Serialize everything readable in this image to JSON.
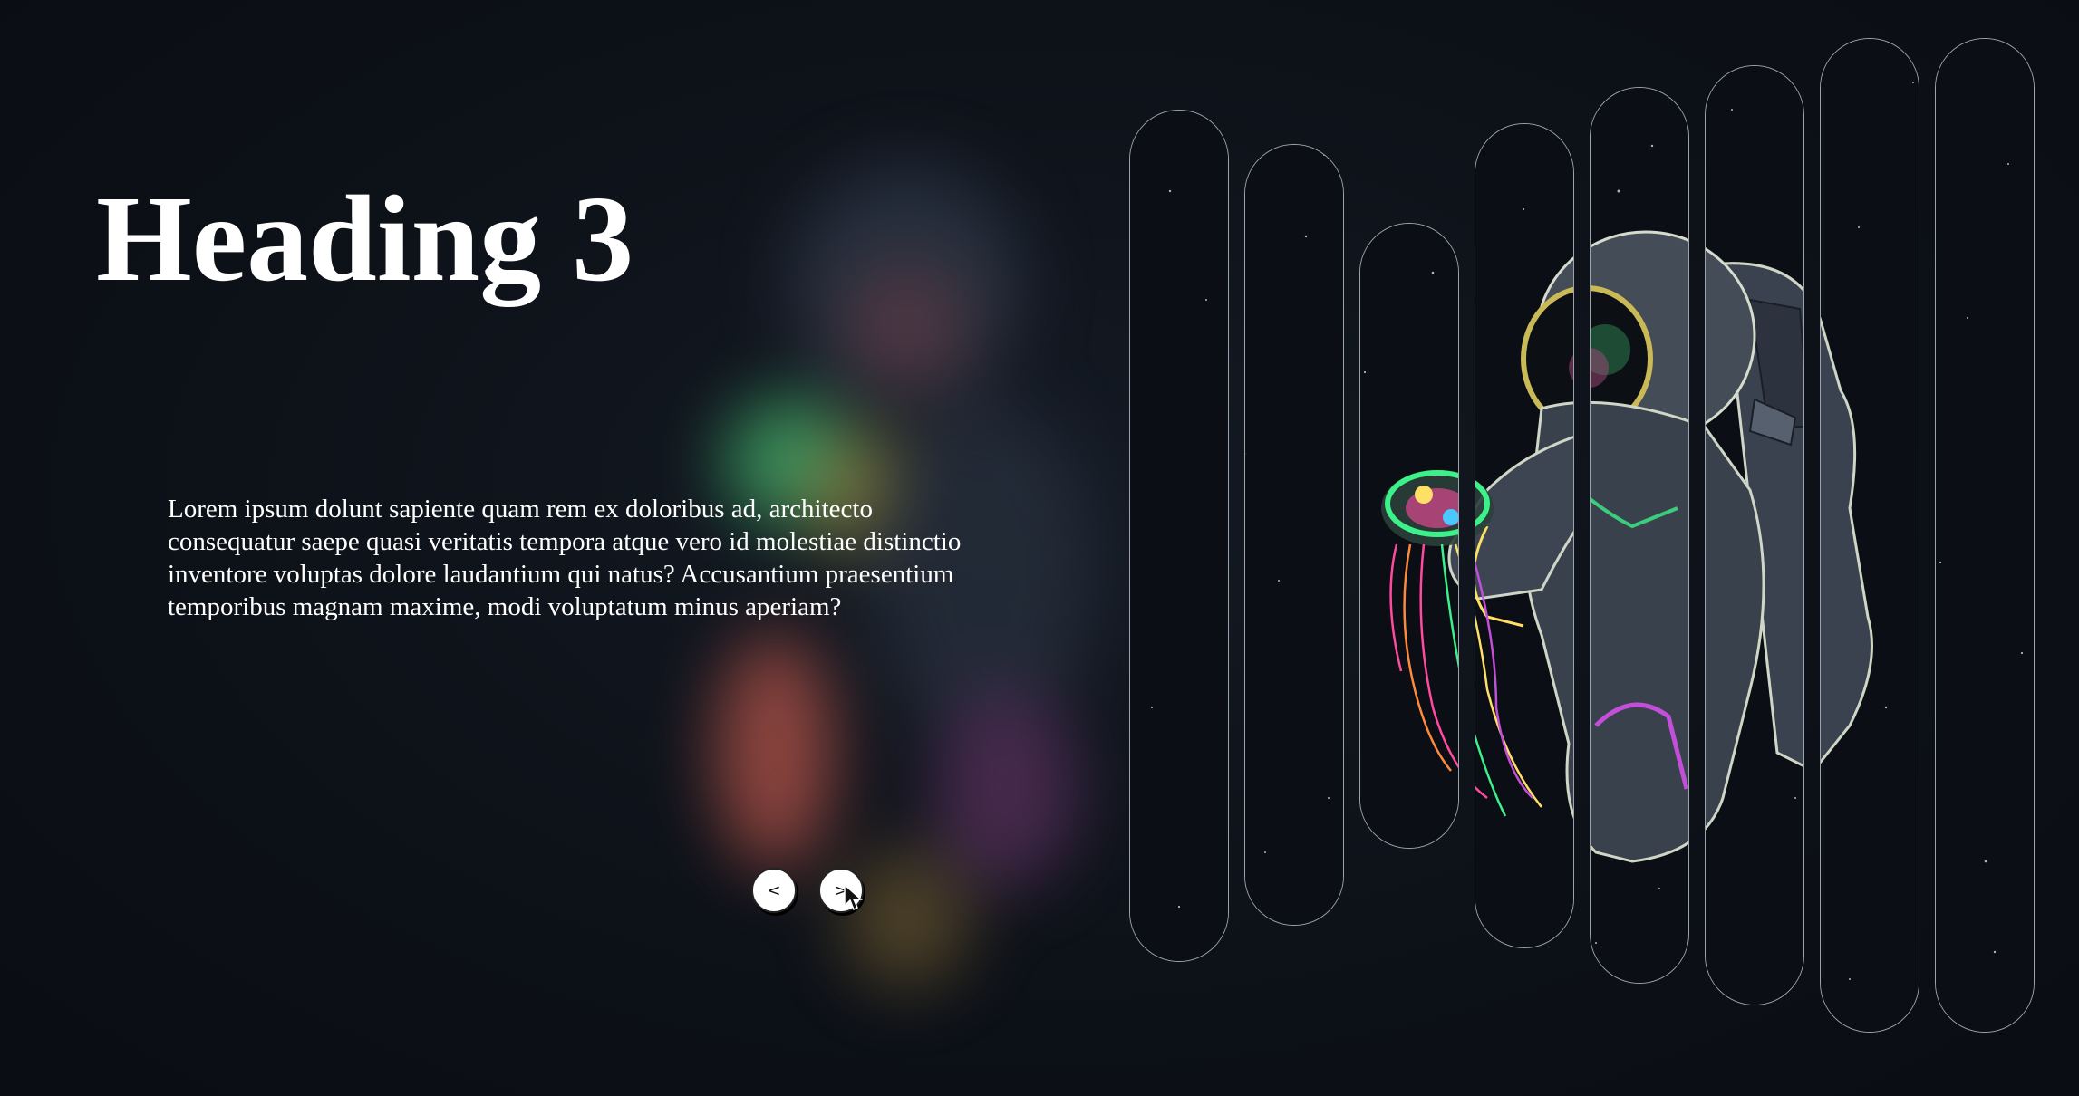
{
  "slide": {
    "heading": "Heading 3",
    "text": "Lorem ipsum dolunt sapiente quam rem ex doloribus ad, architecto consequatur saepe quasi veritatis tempora atque vero id molestiae distinctio inventore voluptas dolore laudantium qui natus? Accusantium praesentium temporibus magnam maxime, modi voluptatum minus aperiam?"
  },
  "nav": {
    "prev_label": "<",
    "next_label": ">"
  },
  "colors": {
    "background": "#0c0f16",
    "text": "#ffffff",
    "strip_border": "#dce1eb",
    "jellyfish_green": "#3cf08a",
    "jellyfish_pink": "#ff4aa0",
    "jellyfish_orange": "#ff8a3c"
  },
  "icons": {
    "cursor": "mouse-pointer-icon",
    "illustration": "astronaut-jellyfish-illustration"
  }
}
